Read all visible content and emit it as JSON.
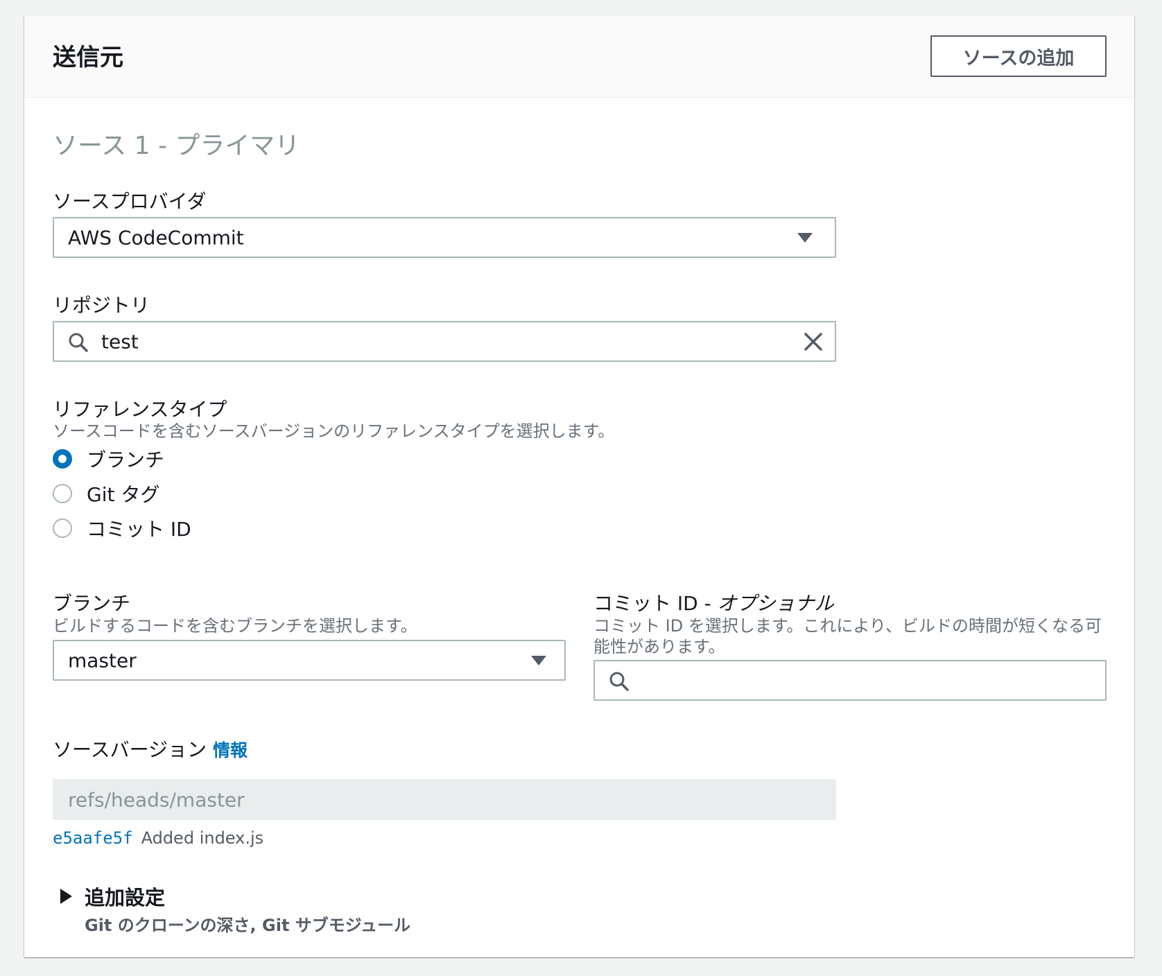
{
  "header": {
    "title": "送信元",
    "add_source_label": "ソースの追加"
  },
  "source": {
    "section_title": "ソース 1 - プライマリ",
    "provider": {
      "label": "ソースプロバイダ",
      "value": "AWS CodeCommit"
    },
    "repository": {
      "label": "リポジトリ",
      "value": "test"
    },
    "reference_type": {
      "label": "リファレンスタイプ",
      "description": "ソースコードを含むソースバージョンのリファレンスタイプを選択します。",
      "options": [
        "ブランチ",
        "Git タグ",
        "コミット ID"
      ],
      "selected": "ブランチ"
    },
    "branch": {
      "label": "ブランチ",
      "description": "ビルドするコードを含むブランチを選択します。",
      "value": "master"
    },
    "commit_id": {
      "label": "コミット ID - ",
      "label_optional": "オプショナル",
      "description": "コミット ID を選択します。これにより、ビルドの時間が短くなる可能性があります。",
      "value": ""
    },
    "source_version": {
      "label": "ソースバージョン",
      "info_link": "情報",
      "value": "refs/heads/master",
      "commit_hash": "e5aafe5f",
      "commit_message": "Added index.js"
    },
    "additional_settings": {
      "title": "追加設定",
      "subtitle": "Git のクローンの深さ, Git サブモジュール"
    }
  },
  "colors": {
    "accent": "#0073bb",
    "border": "#aab7b8",
    "muted_text": "#687078"
  }
}
